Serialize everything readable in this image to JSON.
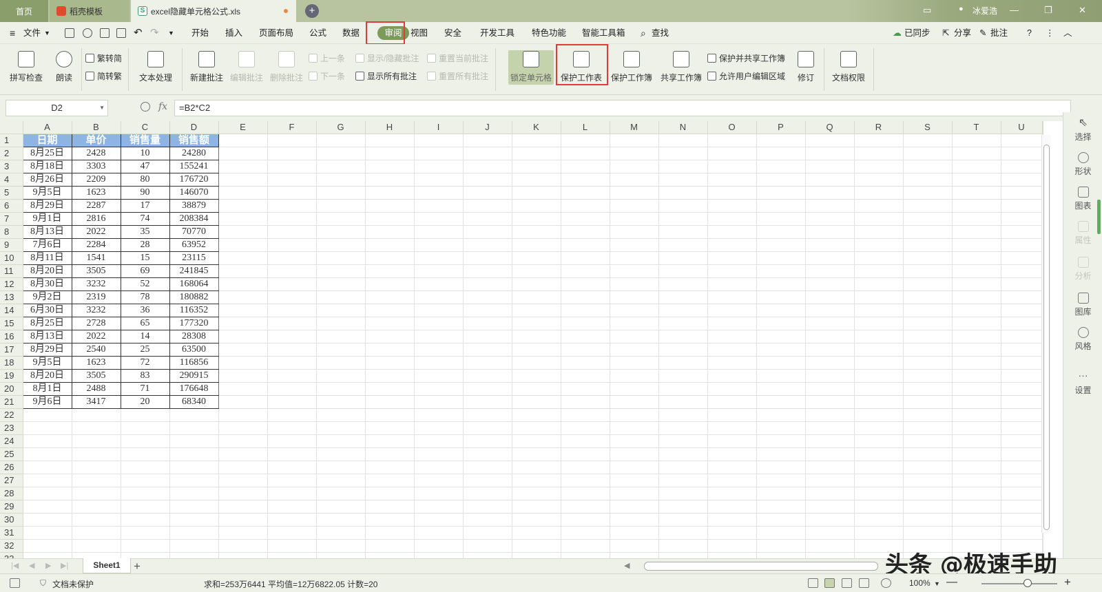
{
  "tabs": {
    "home": "首页",
    "template": "稻壳模板",
    "file": "excel隐藏单元格公式.xls",
    "user": "冰爱浩"
  },
  "menu": {
    "file": "文件",
    "items": [
      "开始",
      "插入",
      "页面布局",
      "公式",
      "数据",
      "审阅",
      "视图",
      "安全",
      "开发工具",
      "特色功能",
      "智能工具箱"
    ],
    "search": "查找",
    "synced": "已同步",
    "share": "分享",
    "annotate": "批注",
    "help": "?"
  },
  "ribbon": {
    "spell_check": "拼写检查",
    "read_aloud": "朗读",
    "to_traditional": "繁转简",
    "to_simplified": "简转繁",
    "text_processing": "文本处理",
    "new_comment": "新建批注",
    "edit_comment": "编辑批注",
    "delete_comment": "删除批注",
    "prev": "上一条",
    "next": "下一条",
    "show_hide_comment": "显示/隐藏批注",
    "show_all_comments": "显示所有批注",
    "reset_current_comment": "重置当前批注",
    "reset_all_comments": "重置所有批注",
    "lock_cell": "锁定单元格",
    "protect_sheet": "保护工作表",
    "protect_workbook": "保护工作簿",
    "share_workbook": "共享工作簿",
    "protect_share_workbook": "保护并共享工作簿",
    "allow_edit_ranges": "允许用户编辑区域",
    "track_changes": "修订",
    "doc_permission": "文档权限"
  },
  "formula_bar": {
    "name_box": "D2",
    "fx": "fx",
    "formula": "=B2*C2"
  },
  "columns": [
    "A",
    "B",
    "C",
    "D",
    "E",
    "F",
    "G",
    "H",
    "I",
    "J",
    "K",
    "L",
    "M",
    "N",
    "O",
    "P",
    "Q",
    "R",
    "S",
    "T",
    "U"
  ],
  "row_count": 33,
  "table": {
    "headers": [
      "日期",
      "单价",
      "销售量",
      "销售额"
    ],
    "rows": [
      [
        "8月25日",
        "2428",
        "10",
        "24280"
      ],
      [
        "8月18日",
        "3303",
        "47",
        "155241"
      ],
      [
        "8月26日",
        "2209",
        "80",
        "176720"
      ],
      [
        "9月5日",
        "1623",
        "90",
        "146070"
      ],
      [
        "8月29日",
        "2287",
        "17",
        "38879"
      ],
      [
        "9月1日",
        "2816",
        "74",
        "208384"
      ],
      [
        "8月13日",
        "2022",
        "35",
        "70770"
      ],
      [
        "7月6日",
        "2284",
        "28",
        "63952"
      ],
      [
        "8月11日",
        "1541",
        "15",
        "23115"
      ],
      [
        "8月20日",
        "3505",
        "69",
        "241845"
      ],
      [
        "8月30日",
        "3232",
        "52",
        "168064"
      ],
      [
        "9月2日",
        "2319",
        "78",
        "180882"
      ],
      [
        "6月30日",
        "3232",
        "36",
        "116352"
      ],
      [
        "8月25日",
        "2728",
        "65",
        "177320"
      ],
      [
        "8月13日",
        "2022",
        "14",
        "28308"
      ],
      [
        "8月29日",
        "2540",
        "25",
        "63500"
      ],
      [
        "9月5日",
        "1623",
        "72",
        "116856"
      ],
      [
        "8月20日",
        "3505",
        "83",
        "290915"
      ],
      [
        "8月1日",
        "2488",
        "71",
        "176648"
      ],
      [
        "9月6日",
        "3417",
        "20",
        "68340"
      ]
    ]
  },
  "sidebar": [
    "选择",
    "形状",
    "图表",
    "属性",
    "分析",
    "图库",
    "风格",
    "设置"
  ],
  "sheet_tab": "Sheet1",
  "status": {
    "protect": "文档未保护",
    "summary": "求和=253万6441  平均值=12万6822.05  计数=20",
    "zoom": "100%"
  },
  "watermark": "头条 @极速手助",
  "colors": {
    "accent": "#7c9a5a",
    "header_fill": "#8db4e2",
    "highlight": "#e23a3a"
  }
}
